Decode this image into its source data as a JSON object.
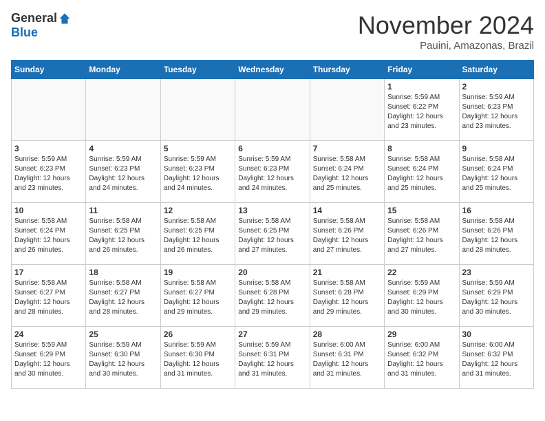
{
  "header": {
    "logo_general": "General",
    "logo_blue": "Blue",
    "month_title": "November 2024",
    "subtitle": "Pauini, Amazonas, Brazil"
  },
  "weekdays": [
    "Sunday",
    "Monday",
    "Tuesday",
    "Wednesday",
    "Thursday",
    "Friday",
    "Saturday"
  ],
  "weeks": [
    [
      {
        "day": "",
        "info": ""
      },
      {
        "day": "",
        "info": ""
      },
      {
        "day": "",
        "info": ""
      },
      {
        "day": "",
        "info": ""
      },
      {
        "day": "",
        "info": ""
      },
      {
        "day": "1",
        "info": "Sunrise: 5:59 AM\nSunset: 6:22 PM\nDaylight: 12 hours\nand 23 minutes."
      },
      {
        "day": "2",
        "info": "Sunrise: 5:59 AM\nSunset: 6:23 PM\nDaylight: 12 hours\nand 23 minutes."
      }
    ],
    [
      {
        "day": "3",
        "info": "Sunrise: 5:59 AM\nSunset: 6:23 PM\nDaylight: 12 hours\nand 23 minutes."
      },
      {
        "day": "4",
        "info": "Sunrise: 5:59 AM\nSunset: 6:23 PM\nDaylight: 12 hours\nand 24 minutes."
      },
      {
        "day": "5",
        "info": "Sunrise: 5:59 AM\nSunset: 6:23 PM\nDaylight: 12 hours\nand 24 minutes."
      },
      {
        "day": "6",
        "info": "Sunrise: 5:59 AM\nSunset: 6:23 PM\nDaylight: 12 hours\nand 24 minutes."
      },
      {
        "day": "7",
        "info": "Sunrise: 5:58 AM\nSunset: 6:24 PM\nDaylight: 12 hours\nand 25 minutes."
      },
      {
        "day": "8",
        "info": "Sunrise: 5:58 AM\nSunset: 6:24 PM\nDaylight: 12 hours\nand 25 minutes."
      },
      {
        "day": "9",
        "info": "Sunrise: 5:58 AM\nSunset: 6:24 PM\nDaylight: 12 hours\nand 25 minutes."
      }
    ],
    [
      {
        "day": "10",
        "info": "Sunrise: 5:58 AM\nSunset: 6:24 PM\nDaylight: 12 hours\nand 26 minutes."
      },
      {
        "day": "11",
        "info": "Sunrise: 5:58 AM\nSunset: 6:25 PM\nDaylight: 12 hours\nand 26 minutes."
      },
      {
        "day": "12",
        "info": "Sunrise: 5:58 AM\nSunset: 6:25 PM\nDaylight: 12 hours\nand 26 minutes."
      },
      {
        "day": "13",
        "info": "Sunrise: 5:58 AM\nSunset: 6:25 PM\nDaylight: 12 hours\nand 27 minutes."
      },
      {
        "day": "14",
        "info": "Sunrise: 5:58 AM\nSunset: 6:26 PM\nDaylight: 12 hours\nand 27 minutes."
      },
      {
        "day": "15",
        "info": "Sunrise: 5:58 AM\nSunset: 6:26 PM\nDaylight: 12 hours\nand 27 minutes."
      },
      {
        "day": "16",
        "info": "Sunrise: 5:58 AM\nSunset: 6:26 PM\nDaylight: 12 hours\nand 28 minutes."
      }
    ],
    [
      {
        "day": "17",
        "info": "Sunrise: 5:58 AM\nSunset: 6:27 PM\nDaylight: 12 hours\nand 28 minutes."
      },
      {
        "day": "18",
        "info": "Sunrise: 5:58 AM\nSunset: 6:27 PM\nDaylight: 12 hours\nand 28 minutes."
      },
      {
        "day": "19",
        "info": "Sunrise: 5:58 AM\nSunset: 6:27 PM\nDaylight: 12 hours\nand 29 minutes."
      },
      {
        "day": "20",
        "info": "Sunrise: 5:58 AM\nSunset: 6:28 PM\nDaylight: 12 hours\nand 29 minutes."
      },
      {
        "day": "21",
        "info": "Sunrise: 5:58 AM\nSunset: 6:28 PM\nDaylight: 12 hours\nand 29 minutes."
      },
      {
        "day": "22",
        "info": "Sunrise: 5:59 AM\nSunset: 6:29 PM\nDaylight: 12 hours\nand 30 minutes."
      },
      {
        "day": "23",
        "info": "Sunrise: 5:59 AM\nSunset: 6:29 PM\nDaylight: 12 hours\nand 30 minutes."
      }
    ],
    [
      {
        "day": "24",
        "info": "Sunrise: 5:59 AM\nSunset: 6:29 PM\nDaylight: 12 hours\nand 30 minutes."
      },
      {
        "day": "25",
        "info": "Sunrise: 5:59 AM\nSunset: 6:30 PM\nDaylight: 12 hours\nand 30 minutes."
      },
      {
        "day": "26",
        "info": "Sunrise: 5:59 AM\nSunset: 6:30 PM\nDaylight: 12 hours\nand 31 minutes."
      },
      {
        "day": "27",
        "info": "Sunrise: 5:59 AM\nSunset: 6:31 PM\nDaylight: 12 hours\nand 31 minutes."
      },
      {
        "day": "28",
        "info": "Sunrise: 6:00 AM\nSunset: 6:31 PM\nDaylight: 12 hours\nand 31 minutes."
      },
      {
        "day": "29",
        "info": "Sunrise: 6:00 AM\nSunset: 6:32 PM\nDaylight: 12 hours\nand 31 minutes."
      },
      {
        "day": "30",
        "info": "Sunrise: 6:00 AM\nSunset: 6:32 PM\nDaylight: 12 hours\nand 31 minutes."
      }
    ]
  ]
}
